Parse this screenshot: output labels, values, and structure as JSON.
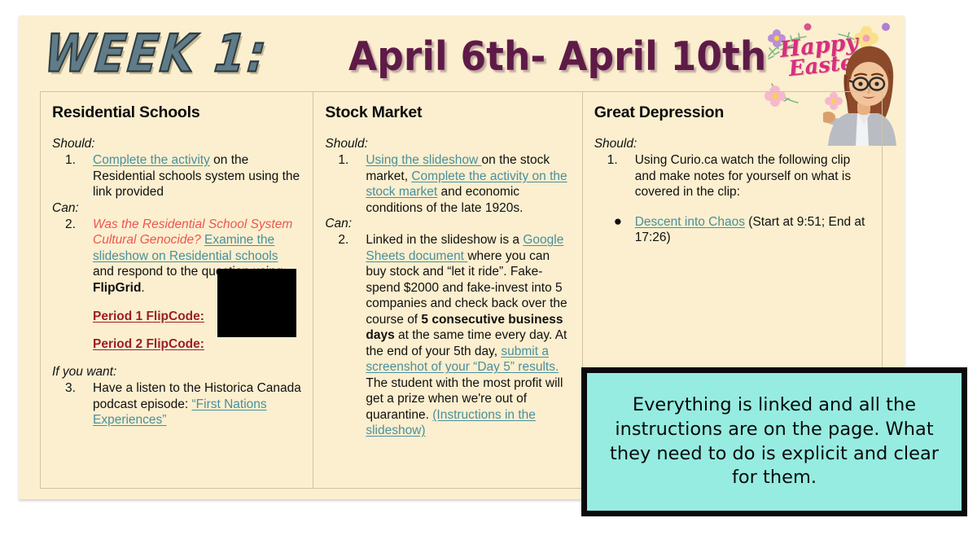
{
  "slide": {
    "week_title": "WEEK 1:",
    "date_title": "April 6th- April 10th",
    "background_color": "#fbefcf",
    "decoration": {
      "easter_line1": "Happy",
      "easter_line2": "Easter",
      "easter_color": "#d62f7f",
      "bitmoji_name": "teacher-bitmoji-avatar"
    }
  },
  "columns": [
    {
      "title": "Residential Schools",
      "blocks": [
        {
          "cue": "Should:"
        },
        {
          "marker": "1.",
          "parts": [
            {
              "text": "Complete the activity",
              "style": "link"
            },
            {
              "text": " on the Residential schools system using the link provided",
              "style": "plain"
            }
          ]
        },
        {
          "cue": "Can:"
        },
        {
          "marker": "2.",
          "parts": [
            {
              "text": "Was the Residential School System Cultural Genocide? ",
              "style": "red-italic"
            },
            {
              "text": "Examine the slideshow on Residential schools",
              "style": "link"
            },
            {
              "text": " and respond to the question using ",
              "style": "plain"
            },
            {
              "text": "FlipGrid",
              "style": "bold"
            },
            {
              "text": ".",
              "style": "plain"
            }
          ]
        },
        {
          "flipcode": "Period 1 FlipCode:"
        },
        {
          "flipcode": "Period 2 FlipCode:"
        },
        {
          "cue": "If you want:"
        },
        {
          "marker": "3.",
          "parts": [
            {
              "text": "Have a listen to the Historica Canada podcast episode: ",
              "style": "plain"
            },
            {
              "text": "“First Nations Experiences”",
              "style": "link"
            }
          ]
        }
      ]
    },
    {
      "title": "Stock Market",
      "blocks": [
        {
          "cue": "Should:"
        },
        {
          "marker": "1.",
          "parts": [
            {
              "text": "Using the slideshow ",
              "style": "link"
            },
            {
              "text": "on the stock market, ",
              "style": "plain"
            },
            {
              "text": "Complete the activity on the stock market",
              "style": "link"
            },
            {
              "text": " and economic conditions of the late 1920s.",
              "style": "plain"
            }
          ]
        },
        {
          "cue": "Can:"
        },
        {
          "marker": "2.",
          "parts": [
            {
              "text": "Linked in the slideshow is a ",
              "style": "plain"
            },
            {
              "text": "Google Sheets document ",
              "style": "link"
            },
            {
              "text": "where you can buy stock and “let it ride”.  Fake-spend $2000 and fake-invest into 5 companies and check back over the course of ",
              "style": "plain"
            },
            {
              "text": "5 consecutive business days",
              "style": "bold"
            },
            {
              "text": " at the same time every day. At the end of your 5th day, ",
              "style": "plain"
            },
            {
              "text": "submit a screenshot of your “Day 5” results.",
              "style": "link"
            },
            {
              "text": " The student with the most profit will get a prize when we're out of quarantine. ",
              "style": "plain"
            },
            {
              "text": "(Instructions in the slideshow)",
              "style": "link"
            }
          ]
        }
      ]
    },
    {
      "title": "Great Depression",
      "blocks": [
        {
          "cue": "Should:"
        },
        {
          "marker": "1.",
          "parts": [
            {
              "text": "Using Curio.ca watch the following clip and make notes for yourself on what is covered in the clip:",
              "style": "plain"
            }
          ]
        },
        {
          "spacer": true
        },
        {
          "marker": "●",
          "bullet": true,
          "parts": [
            {
              "text": "Descent into Chaos",
              "style": "link"
            },
            {
              "text": " (Start at 9:51; End at 17:26)",
              "style": "plain"
            }
          ]
        }
      ]
    }
  ],
  "callout": {
    "text": "Everything is linked and all the instructions are on the page.  What they need to do is explicit and clear for them.",
    "background_color": "#96ece1",
    "border_color": "#0a0a0a"
  },
  "redaction": {
    "label": "redacted-flipcode-block",
    "color": "#000000"
  }
}
